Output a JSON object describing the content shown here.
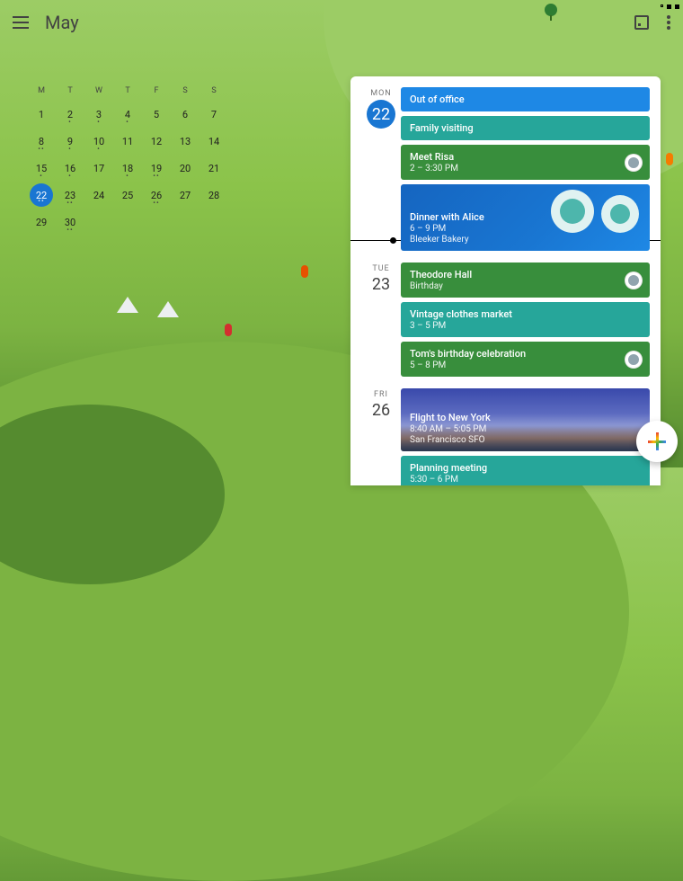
{
  "header": {
    "title": "May"
  },
  "mini_cal": {
    "dow": [
      "M",
      "T",
      "W",
      "T",
      "F",
      "S",
      "S"
    ],
    "weeks": [
      [
        {
          "n": "1",
          "d": 0
        },
        {
          "n": "2",
          "d": 1
        },
        {
          "n": "3",
          "d": 1
        },
        {
          "n": "4",
          "d": 1
        },
        {
          "n": "5",
          "d": 0
        },
        {
          "n": "6",
          "d": 0
        },
        {
          "n": "7",
          "d": 0
        }
      ],
      [
        {
          "n": "8",
          "d": 2
        },
        {
          "n": "9",
          "d": 1
        },
        {
          "n": "10",
          "d": 1
        },
        {
          "n": "11",
          "d": 0
        },
        {
          "n": "12",
          "d": 0
        },
        {
          "n": "13",
          "d": 0
        },
        {
          "n": "14",
          "d": 0
        }
      ],
      [
        {
          "n": "15",
          "d": 1
        },
        {
          "n": "16",
          "d": 1
        },
        {
          "n": "17",
          "d": 0
        },
        {
          "n": "18",
          "d": 1
        },
        {
          "n": "19",
          "d": 2
        },
        {
          "n": "20",
          "d": 0
        },
        {
          "n": "21",
          "d": 0
        }
      ],
      [
        {
          "n": "22",
          "d": 2,
          "sel": true
        },
        {
          "n": "23",
          "d": 2
        },
        {
          "n": "24",
          "d": 0
        },
        {
          "n": "25",
          "d": 0
        },
        {
          "n": "26",
          "d": 2
        },
        {
          "n": "27",
          "d": 0
        },
        {
          "n": "28",
          "d": 0
        }
      ],
      [
        {
          "n": "29",
          "d": 0
        },
        {
          "n": "30",
          "d": 2
        },
        {
          "n": "",
          "d": 0
        },
        {
          "n": "",
          "d": 0
        },
        {
          "n": "",
          "d": 0
        },
        {
          "n": "",
          "d": 0
        },
        {
          "n": "",
          "d": 0
        }
      ]
    ]
  },
  "agenda": [
    {
      "wd": "MON",
      "dn": "22",
      "today": true,
      "events": [
        {
          "title": "Out of office",
          "sub": "",
          "color": "blue"
        },
        {
          "title": "Family visiting",
          "sub": "",
          "color": "teal"
        },
        {
          "title": "Meet Risa",
          "sub": "2 – 3:30 PM",
          "color": "green",
          "avatar": true
        },
        {
          "title": "Dinner with Alice",
          "sub": "6 – 9 PM",
          "loc": "Bleeker Bakery",
          "color": "dinner"
        }
      ]
    },
    {
      "wd": "TUE",
      "dn": "23",
      "events": [
        {
          "title": "Theodore Hall",
          "sub": "Birthday",
          "color": "green",
          "avatar": true
        },
        {
          "title": "Vintage clothes market",
          "sub": "3 – 5 PM",
          "color": "teal"
        },
        {
          "title": "Tom's birthday celebration",
          "sub": "5 – 8 PM",
          "color": "green",
          "avatar": true
        }
      ]
    },
    {
      "wd": "FRI",
      "dn": "26",
      "events": [
        {
          "title": "Flight to New York",
          "sub": "8:40 AM – 5:05 PM",
          "loc": "San Francisco SFO",
          "color": "skyline"
        },
        {
          "title": "Planning meeting",
          "sub": "5:30 – 6 PM",
          "color": "teal"
        }
      ]
    }
  ]
}
